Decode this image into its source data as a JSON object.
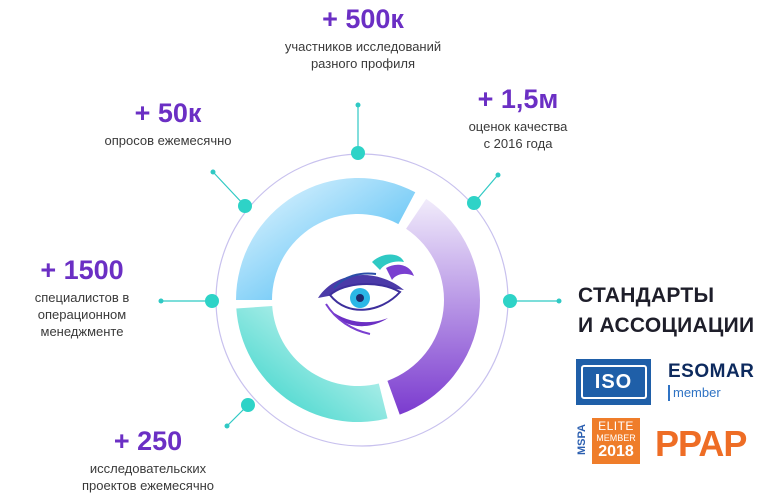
{
  "stats": [
    {
      "id": "participants",
      "number": "+ 500к",
      "desc": [
        "участников исследований",
        "разного профиля"
      ]
    },
    {
      "id": "ratings",
      "number": "+ 1,5м",
      "desc": [
        "оценок качества",
        "с 2016 года"
      ]
    },
    {
      "id": "surveys",
      "number": "+ 50к",
      "desc": [
        "опросов ежемесячно"
      ]
    },
    {
      "id": "specialists",
      "number": "+ 1500",
      "desc": [
        "специалистов в",
        "операционном",
        "менеджменте"
      ]
    },
    {
      "id": "projects",
      "number": "+ 250",
      "desc": [
        "исследовательских",
        "проектов ежемесячно"
      ]
    }
  ],
  "standards": {
    "title_line1": "СТАНДАРТЫ",
    "title_line2": "И АССОЦИАЦИИ"
  },
  "logos": {
    "iso": "ISO",
    "esomar": "ESOMAR",
    "esomar_sub": "member",
    "mspa": "MSPA",
    "elite": "ELITE",
    "elite_member": "MEMBER",
    "elite_year": "2018",
    "ppap": "PPAP"
  },
  "colors": {
    "accent": "#6b2fc4",
    "teal": "#2ed3c7",
    "blue": "#37b6f0",
    "purple": "#7d3fd0",
    "orange": "#ef7d2a"
  },
  "icons": {
    "center": "eye-bird-icon"
  }
}
